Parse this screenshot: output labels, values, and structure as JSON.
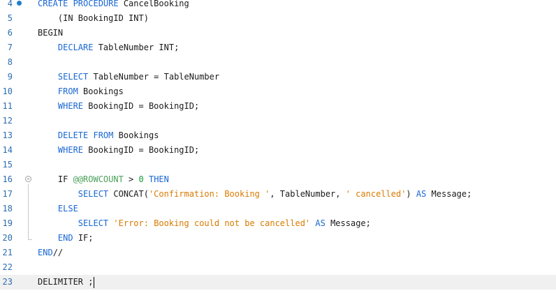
{
  "editor": {
    "lines": [
      {
        "num": "4",
        "tokens": [
          [
            "kw",
            "CREATE PROCEDURE"
          ],
          [
            "t",
            " CancelBooking"
          ]
        ]
      },
      {
        "num": "5",
        "tokens": [
          [
            "t",
            "    (IN BookingID INT)"
          ]
        ]
      },
      {
        "num": "6",
        "tokens": [
          [
            "t",
            "BEGIN"
          ]
        ]
      },
      {
        "num": "7",
        "tokens": [
          [
            "t",
            "    "
          ],
          [
            "kw",
            "DECLARE"
          ],
          [
            "t",
            " TableNumber INT;"
          ]
        ]
      },
      {
        "num": "8",
        "tokens": []
      },
      {
        "num": "9",
        "tokens": [
          [
            "t",
            "    "
          ],
          [
            "kw",
            "SELECT"
          ],
          [
            "t",
            " TableNumber = TableNumber"
          ]
        ]
      },
      {
        "num": "10",
        "tokens": [
          [
            "t",
            "    "
          ],
          [
            "kw",
            "FROM"
          ],
          [
            "t",
            " Bookings"
          ]
        ]
      },
      {
        "num": "11",
        "tokens": [
          [
            "t",
            "    "
          ],
          [
            "kw",
            "WHERE"
          ],
          [
            "t",
            " BookingID = BookingID;"
          ]
        ]
      },
      {
        "num": "12",
        "tokens": []
      },
      {
        "num": "13",
        "tokens": [
          [
            "t",
            "    "
          ],
          [
            "kw",
            "DELETE FROM"
          ],
          [
            "t",
            " Bookings"
          ]
        ]
      },
      {
        "num": "14",
        "tokens": [
          [
            "t",
            "    "
          ],
          [
            "kw",
            "WHERE"
          ],
          [
            "t",
            " BookingID = BookingID;"
          ]
        ]
      },
      {
        "num": "15",
        "tokens": []
      },
      {
        "num": "16",
        "tokens": [
          [
            "t",
            "    IF "
          ],
          [
            "fn",
            "@@ROWCOUNT"
          ],
          [
            "t",
            " > "
          ],
          [
            "n",
            "0"
          ],
          [
            "t",
            " "
          ],
          [
            "kw",
            "THEN"
          ]
        ]
      },
      {
        "num": "17",
        "tokens": [
          [
            "t",
            "        "
          ],
          [
            "kw",
            "SELECT"
          ],
          [
            "t",
            " CONCAT("
          ],
          [
            "str",
            "'Confirmation: Booking '"
          ],
          [
            "t",
            ", TableNumber, "
          ],
          [
            "str",
            "' cancelled'"
          ],
          [
            "t",
            ") "
          ],
          [
            "kw",
            "AS"
          ],
          [
            "t",
            " Message;"
          ]
        ]
      },
      {
        "num": "18",
        "tokens": [
          [
            "t",
            "    "
          ],
          [
            "kw",
            "ELSE"
          ]
        ]
      },
      {
        "num": "19",
        "tokens": [
          [
            "t",
            "        "
          ],
          [
            "kw",
            "SELECT"
          ],
          [
            "t",
            " "
          ],
          [
            "str",
            "'Error: Booking could not be cancelled'"
          ],
          [
            "t",
            " "
          ],
          [
            "kw",
            "AS"
          ],
          [
            "t",
            " Message;"
          ]
        ]
      },
      {
        "num": "20",
        "tokens": [
          [
            "t",
            "    "
          ],
          [
            "kw",
            "END"
          ],
          [
            "t",
            " IF;"
          ]
        ]
      },
      {
        "num": "21",
        "tokens": [
          [
            "kw",
            "END"
          ],
          [
            "t",
            "//"
          ]
        ]
      },
      {
        "num": "22",
        "tokens": []
      },
      {
        "num": "23",
        "tokens": [
          [
            "t",
            "DELIMITER ;"
          ]
        ]
      }
    ]
  }
}
